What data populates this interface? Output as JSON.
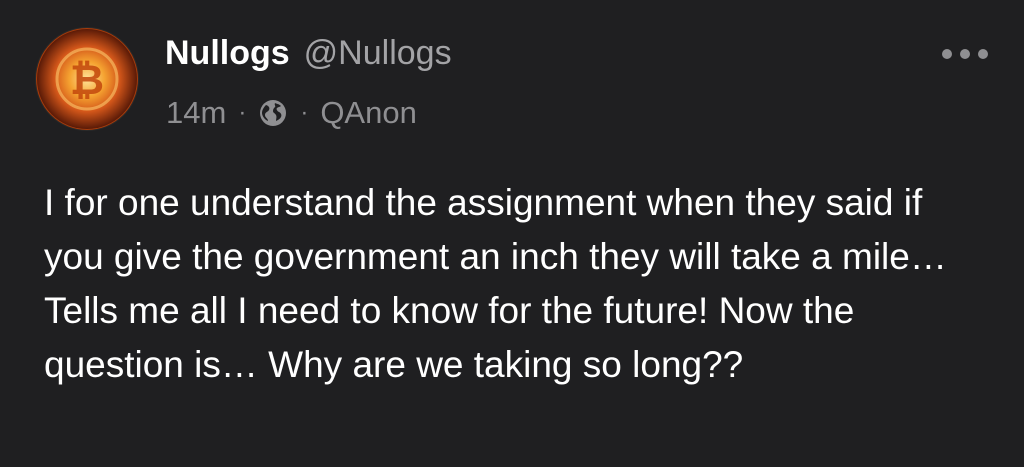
{
  "post": {
    "author": {
      "display_name": "Nullogs",
      "handle": "@Nullogs",
      "avatar_icon": "bitcoin-sun-icon"
    },
    "meta": {
      "time": "14m",
      "separator": "·",
      "visibility_icon": "globe-icon",
      "community": "QAnon"
    },
    "more_icon": "more-options-icon",
    "text": "I for one understand the assignment when they said if you give the government an inch they will take a mile… Tells me all I need to know for the future! Now the question is… Why are we taking so long??"
  },
  "colors": {
    "background": "#1f1f21",
    "primary_text": "#ffffff",
    "secondary_text": "#8f8f92",
    "avatar_accent": "#f39a2c"
  }
}
